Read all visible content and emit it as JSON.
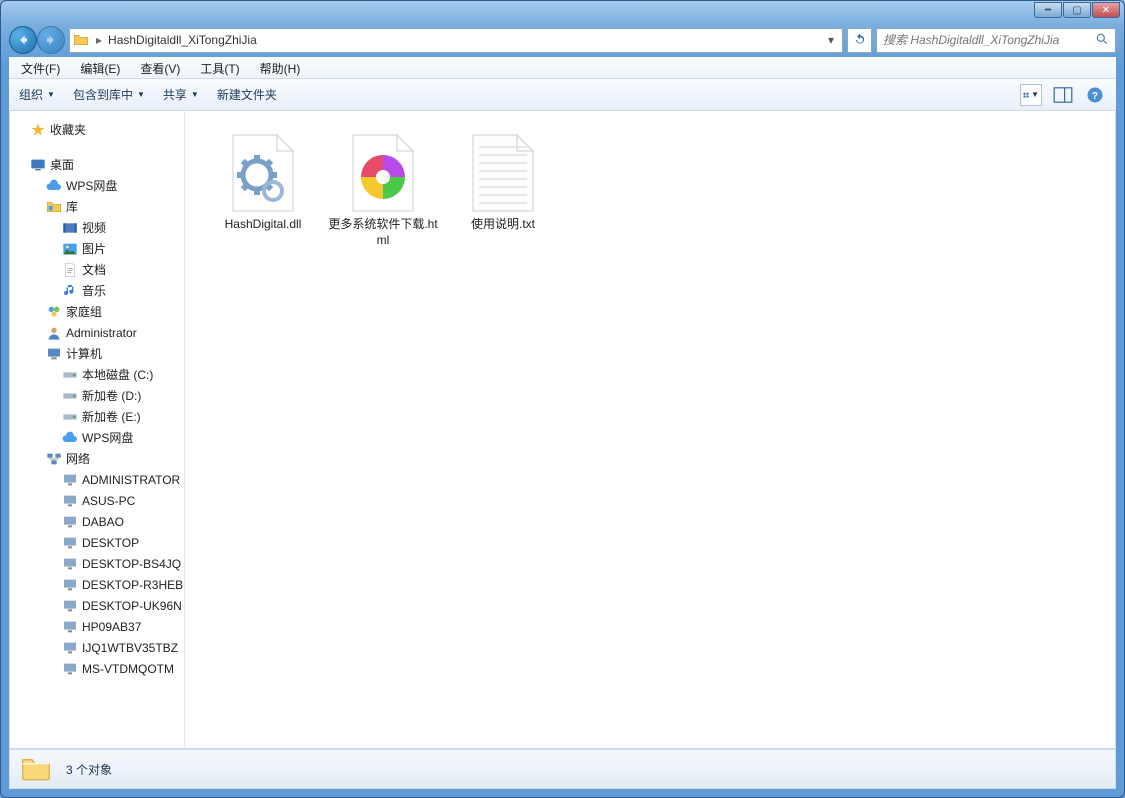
{
  "window": {
    "minimize": "━",
    "maximize": "▢",
    "close": "✕"
  },
  "breadcrumb": {
    "path": "HashDigitaldll_XiTongZhiJia"
  },
  "search": {
    "placeholder": "搜索 HashDigitaldll_XiTongZhiJia"
  },
  "menubar": {
    "file": "文件(F)",
    "edit": "编辑(E)",
    "view": "查看(V)",
    "tools": "工具(T)",
    "help": "帮助(H)"
  },
  "toolbar": {
    "organize": "组织",
    "include": "包含到库中",
    "share": "共享",
    "newfolder": "新建文件夹"
  },
  "sidebar": {
    "favorites": "收藏夹",
    "desktop": "桌面",
    "wps": "WPS网盘",
    "libraries": "库",
    "videos": "视频",
    "pictures": "图片",
    "documents": "文档",
    "music": "音乐",
    "homegroup": "家庭组",
    "admin": "Administrator",
    "computer": "计算机",
    "driveC": "本地磁盘 (C:)",
    "driveD": "新加卷 (D:)",
    "driveE": "新加卷 (E:)",
    "wps2": "WPS网盘",
    "network": "网络",
    "net": {
      "n1": "ADMINISTRATOR",
      "n2": "ASUS-PC",
      "n3": "DABAO",
      "n4": "DESKTOP",
      "n5": "DESKTOP-BS4JQ",
      "n6": "DESKTOP-R3HEB",
      "n7": "DESKTOP-UK96N",
      "n8": "HP09AB37",
      "n9": "IJQ1WTBV35TBZ",
      "n10": "MS-VTDMQOTM"
    }
  },
  "files": {
    "f1": "HashDigital.dll",
    "f2": "更多系统软件下载.html",
    "f3": "使用说明.txt"
  },
  "status": {
    "text": "3 个对象"
  }
}
